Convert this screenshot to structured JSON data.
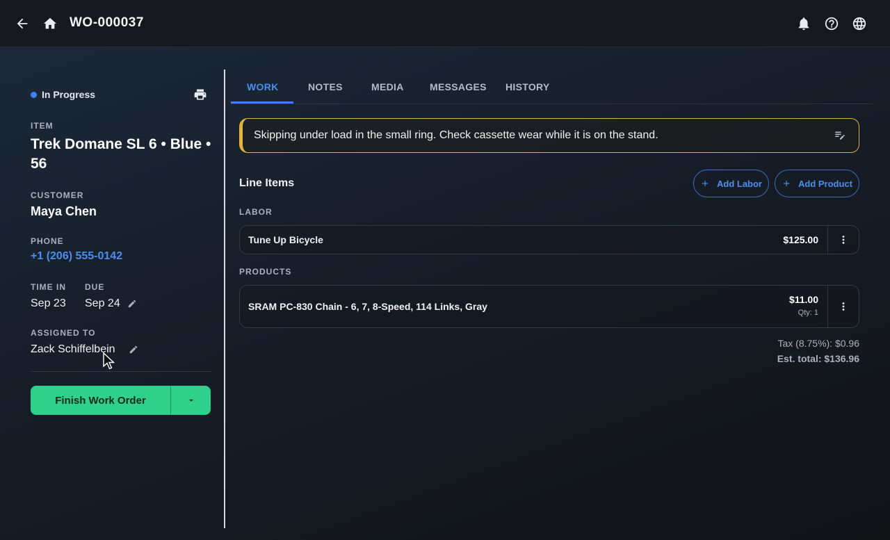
{
  "header": {
    "title": "WO-000037",
    "icons": [
      "back-arrow-icon",
      "home-icon",
      "bell-icon",
      "help-icon",
      "globe-icon"
    ]
  },
  "left": {
    "status": "In Progress",
    "item_label": "ITEM",
    "item_name": "Trek Domane SL 6 • Blue • 56",
    "customer_label": "CUSTOMER",
    "customer_name": "Maya Chen",
    "phone_label": "PHONE",
    "phone": "+1 (206) 555-0142",
    "time_in_label": "TIME IN",
    "time_in": "Sep 23",
    "due_label": "DUE",
    "due": "Sep 24",
    "assigned_label": "ASSIGNED TO",
    "assigned": "Zack Schiffelbein",
    "finish_button": "Finish Work Order"
  },
  "tabs": [
    "WORK",
    "NOTES",
    "MEDIA",
    "MESSAGES",
    "HISTORY"
  ],
  "note": "Skipping under load in the small ring. Check cassette wear while it is on the stand.",
  "line_items": {
    "title": "Line Items",
    "add_labor": "Add Labor",
    "add_product": "Add Product",
    "labor_label": "LABOR",
    "labor": [
      {
        "name": "Tune Up Bicycle",
        "price": "$125.00"
      }
    ],
    "products_label": "PRODUCTS",
    "products": [
      {
        "name": "SRAM PC-830 Chain - 6, 7, 8-Speed, 114 Links, Gray",
        "price": "$11.00",
        "qty": "Qty: 1"
      }
    ],
    "tax": "Tax (8.75%): $0.96",
    "total": "Est. total: $136.96"
  },
  "colors": {
    "accent": "#3b82f6",
    "finish_green": "#2fd08c",
    "note_border": "#e0b43a"
  }
}
